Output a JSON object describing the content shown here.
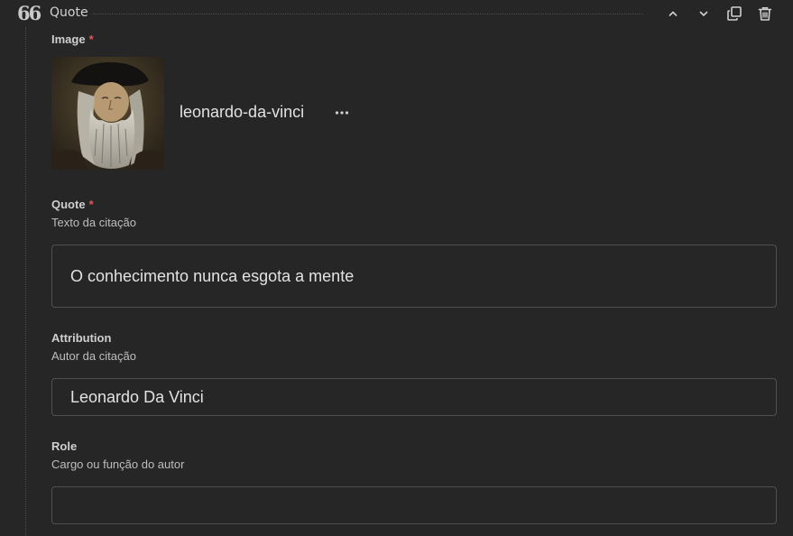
{
  "block": {
    "title": "Quote",
    "glyph": "66"
  },
  "fields": {
    "image": {
      "label": "Image",
      "required_mark": "*",
      "file_name": "leonardo-da-vinci",
      "more_label": "•••"
    },
    "quote": {
      "label": "Quote",
      "required_mark": "*",
      "hint": "Texto da citação",
      "value": "O conhecimento nunca esgota a mente"
    },
    "attribution": {
      "label": "Attribution",
      "hint": "Autor da citação",
      "value": "Leonardo Da Vinci"
    },
    "role": {
      "label": "Role",
      "hint": "Cargo ou função do autor",
      "value": ""
    }
  },
  "colors": {
    "background": "#262626",
    "required": "#e05757",
    "border": "#4f4f4f"
  },
  "icons": {
    "header": [
      "quote-icon",
      "chevron-up-icon",
      "chevron-down-icon",
      "duplicate-icon",
      "trash-icon"
    ],
    "image_actions": "more-horizontal-icon"
  }
}
